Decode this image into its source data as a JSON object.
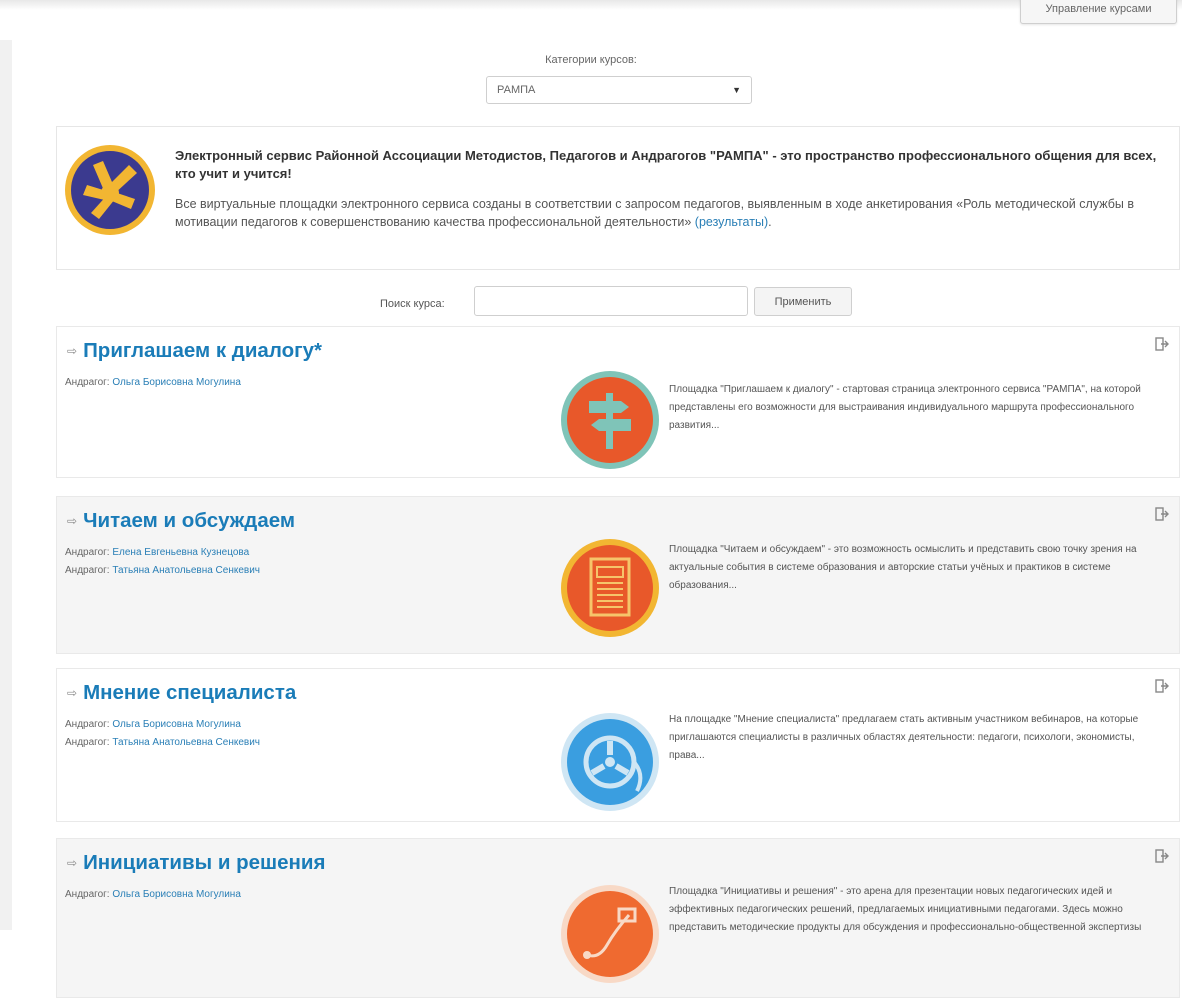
{
  "top_button": {
    "label": "Управление курсами"
  },
  "category": {
    "label": "Категории курсов:",
    "selected": "РАМПА"
  },
  "intro": {
    "title": "Электронный сервис Районной Ассоциации Методистов, Педагогов и Андрагогов \"РАМПА\" - это пространство профессионального общения для всех, кто учит и учится!",
    "text": "Все виртуальные площадки электронного сервиса созданы в соответствии с запросом педагогов, выявленным в ходе анкетирования «Роль методической службы в мотивации педагогов к совершенствованию качества профессиональной деятельности» ",
    "link": "(результаты)",
    "text_end": "."
  },
  "search": {
    "label": "Поиск курса:",
    "placeholder": "",
    "button": "Применить"
  },
  "courses": [
    {
      "title": "Приглашаем к диалогу*",
      "teachers": [
        {
          "role": "Андрагог:",
          "name": "Ольга Борисовна Могулина"
        }
      ],
      "desc": "Площадка \"Приглашаем к диалогу\" - стартовая страница электронного сервиса \"РАМПА\", на которой представлены его возможности для выстраивания индивидуального маршрута профессионального развития...",
      "icon": "signpost-icon"
    },
    {
      "title": "Читаем и обсуждаем",
      "teachers": [
        {
          "role": "Андрагог:",
          "name": "Елена Евгеньевна Кузнецова"
        },
        {
          "role": "Андрагог:",
          "name": "Татьяна Анатольевна Сенкевич"
        }
      ],
      "desc": "Площадка \"Читаем и обсуждаем\" - это возможность осмыслить и представить свою точку зрения на актуальные события в системе образования и авторские статьи учёных и практиков в системе образования...",
      "icon": "newspaper-icon"
    },
    {
      "title": "Мнение специалиста",
      "teachers": [
        {
          "role": "Андрагог:",
          "name": "Ольга Борисовна Могулина"
        },
        {
          "role": "Андрагог:",
          "name": "Татьяна Анатольевна Сенкевич"
        }
      ],
      "desc": "На площадке \"Мнение специалиста\" предлагаем стать активным участником вебинаров, на которые приглашаются специалисты в различных областях деятельности: педагоги, психологи, экономисты, права...",
      "icon": "film-reel-icon"
    },
    {
      "title": "Инициативы и решения",
      "teachers": [
        {
          "role": "Андрагог:",
          "name": "Ольга Борисовна Могулина"
        }
      ],
      "desc": "Площадка \"Инициативы и решения\" - это арена для презентации новых педагогических идей и эффективных педагогических решений, предлагаемых инициативными педагогами. Здесь можно представить методические продукты для обсуждения и профессионально-общественной экспертизы",
      "icon": "route-icon"
    }
  ]
}
